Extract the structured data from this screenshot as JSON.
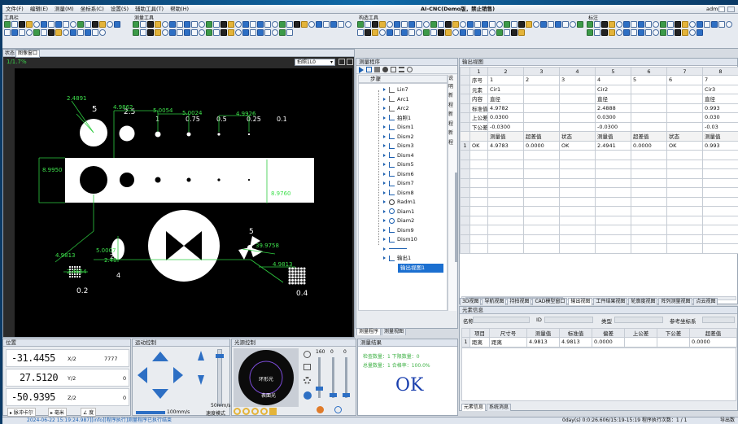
{
  "window": {
    "title": "AI-CNC(Demo版，禁止销售)",
    "user": "admin"
  },
  "menu": [
    "文件(F)",
    "编辑(E)",
    "测量(M)",
    "坐标系(C)",
    "设置(S)",
    "辅助工具(T)",
    "帮助(H)"
  ],
  "toolbars": {
    "left_title": "工具栏",
    "measure_title": "测量工具",
    "construct_title": "构造工具",
    "annot_title": "标注"
  },
  "viewport": {
    "tabs": [
      "状态",
      "图像窗口"
    ],
    "zoom": "1/1.7%",
    "capture_select": "拍照1L0",
    "annotations": [
      {
        "t": "2.4891"
      },
      {
        "t": "4.9862"
      },
      {
        "t": "5.0054"
      },
      {
        "t": "5.0024"
      },
      {
        "t": "4.9926"
      },
      {
        "t": "8.9950"
      },
      {
        "t": "8.9760"
      },
      {
        "t": "4.9813"
      },
      {
        "t": "5.0007"
      },
      {
        "t": "39.9758"
      },
      {
        "t": "4.9813"
      },
      {
        "t": "2.4654"
      },
      {
        "t": "2.48"
      }
    ],
    "target_labels": [
      "5",
      "2.5",
      "1",
      "0.75",
      "0.5",
      "0.25",
      "0.1",
      "5",
      "2",
      "4",
      "0.2",
      "0.4"
    ]
  },
  "program": {
    "title": "测量程序",
    "col_step": "步骤",
    "col_desc": "说明",
    "desc_values": [
      "新程",
      "新程",
      "新程"
    ],
    "items": [
      {
        "label": "Lin7",
        "icon": "line"
      },
      {
        "label": "Arc1",
        "icon": "arc"
      },
      {
        "label": "Arc2",
        "icon": "arc"
      },
      {
        "label": "拍照1",
        "icon": "camera"
      },
      {
        "label": "Dism1",
        "icon": "dist"
      },
      {
        "label": "Dism2",
        "icon": "dist"
      },
      {
        "label": "Dism3",
        "icon": "dist"
      },
      {
        "label": "Dism4",
        "icon": "dist"
      },
      {
        "label": "Dism5",
        "icon": "dist"
      },
      {
        "label": "Dism6",
        "icon": "dist"
      },
      {
        "label": "Dism7",
        "icon": "dist"
      },
      {
        "label": "Dism8",
        "icon": "dist"
      },
      {
        "label": "Radm1",
        "icon": "radius"
      },
      {
        "label": "Diam1",
        "icon": "diam"
      },
      {
        "label": "Diam2",
        "icon": "diam"
      },
      {
        "label": "Dism9",
        "icon": "dist"
      },
      {
        "label": "Dism10",
        "icon": "dist"
      },
      {
        "label": "",
        "icon": "arrow"
      },
      {
        "label": "输出1",
        "icon": "output"
      },
      {
        "label": "输出视图1",
        "icon": "selected"
      }
    ],
    "tabs": [
      "测量程序",
      "测量视图"
    ]
  },
  "output": {
    "title": "输出视图",
    "col_headers": [
      "1",
      "2",
      "3",
      "4",
      "5",
      "6",
      "7",
      "8",
      "9"
    ],
    "rows": [
      {
        "rh": "",
        "cells": [
          "",
          "序号",
          "1",
          "2",
          "3",
          "4",
          "5",
          "6",
          "7"
        ]
      },
      {
        "rh": "",
        "cells": [
          "",
          "元素",
          "Cir1",
          "",
          "",
          "Cir2",
          "",
          "",
          "Cir3"
        ]
      },
      {
        "rh": "",
        "cells": [
          "",
          "内容",
          "直径",
          "",
          "",
          "直径",
          "",
          "",
          "直径"
        ]
      },
      {
        "rh": "",
        "cells": [
          "",
          "标准值",
          "4.9782",
          "",
          "",
          "2.4888",
          "",
          "",
          "0.993"
        ]
      },
      {
        "rh": "",
        "cells": [
          "",
          "上公差",
          "0.0300",
          "",
          "",
          "0.0300",
          "",
          "",
          "0.030"
        ]
      },
      {
        "rh": "",
        "cells": [
          "",
          "下公差",
          "-0.0300",
          "",
          "",
          "-0.0300",
          "",
          "",
          "-0.03"
        ]
      },
      {
        "rh": "",
        "cells": [
          "",
          "",
          "测量值",
          "超差值",
          "状态",
          "测量值",
          "超差值",
          "状态",
          "测量值"
        ]
      },
      {
        "rh": "1",
        "cells": [
          "1",
          "OK",
          "4.9783",
          "0.0000",
          "OK",
          "2.4941",
          "0.0000",
          "OK",
          "0.993"
        ]
      }
    ],
    "tabs": [
      "3D视图",
      "导航视图",
      "持拍视图",
      "CAD模型窗口",
      "输出视图",
      "工件结果视图",
      "轮廓度视图",
      "阵列测量视图",
      "点云视图"
    ]
  },
  "element_info": {
    "title": "元素信息",
    "name_label": "名称",
    "id_label": "ID",
    "type_label": "类型",
    "coord_label": "参考坐标系",
    "headers": [
      "项目",
      "尺寸号",
      "测量值",
      "标准值",
      "偏差",
      "上公差",
      "下公差",
      "超差值"
    ],
    "row": [
      "1",
      "距离",
      "距离",
      "4.9813",
      "4.9813",
      "0.0000",
      "",
      "",
      "0.0000"
    ],
    "tabs": [
      "元素信息",
      "系统消息"
    ]
  },
  "position": {
    "title": "位置",
    "x": "-31.4455",
    "x_lbl": "X/2",
    "x_val2": "7777",
    "y": "27.5120",
    "y_lbl": "Y/2",
    "y_val2": "0",
    "z": "-50.9395",
    "z_lbl": "Z/2",
    "z_val2": "0",
    "unit_a": "脉冲卡尔",
    "unit_b": "毫米",
    "unit_c": "度"
  },
  "motion": {
    "title": "运动控制",
    "speed": "100mm/s",
    "speed2": "50mm/s",
    "mode": "速度模式"
  },
  "light": {
    "title": "光源控制",
    "ring": "环形光",
    "bottom": "表面光",
    "v1": "160",
    "v2": "0",
    "v3": "0"
  },
  "result": {
    "title": "测量结果",
    "line1": "检查数量：1  下限数量：0",
    "line2": "总量数量：1  合格率：100.0%",
    "status": "OK"
  },
  "status_bar": {
    "left": "2024-06-22 15:19:24.987][info][程序执行]测量程序已执行结束",
    "right": "0day(s) 0:0:26.606/15:19-15:19  程序执行次数：1 / 1",
    "end": "导出数"
  },
  "colors": {
    "accent": "#2d6fc4",
    "ok": "#1a3fae",
    "measure_green": "#2ecc40"
  }
}
